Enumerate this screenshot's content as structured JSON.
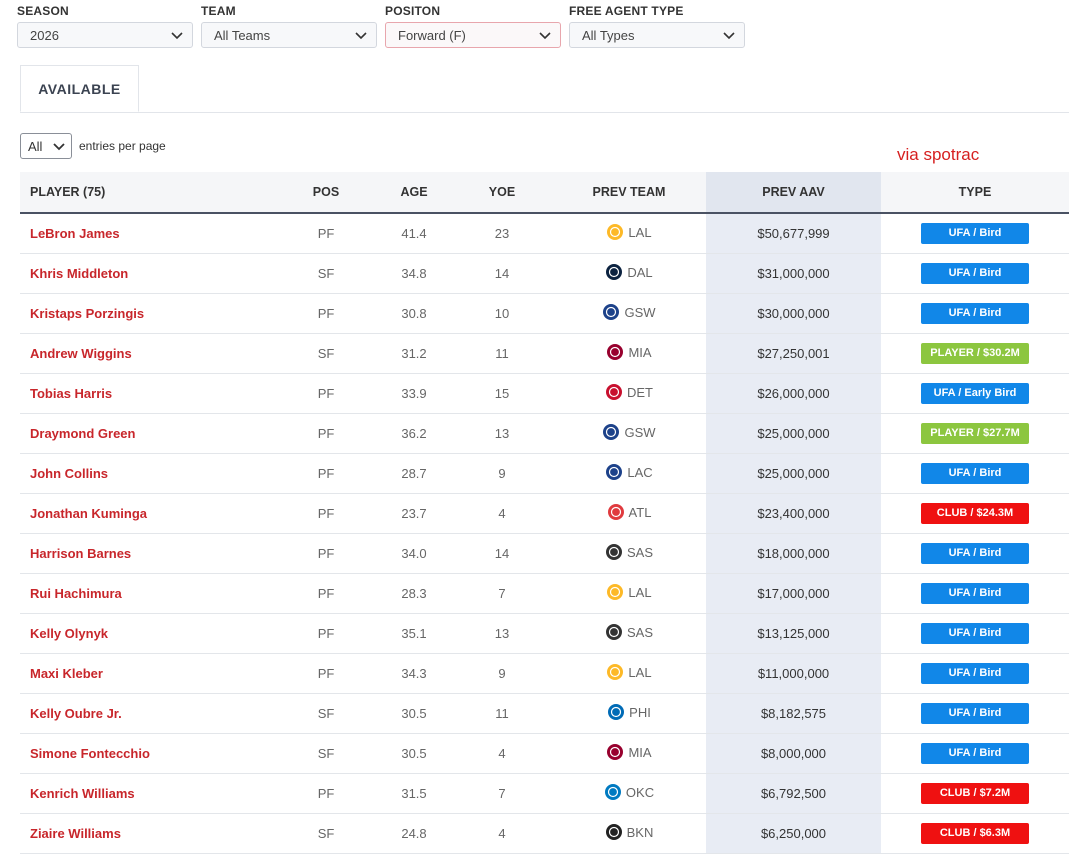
{
  "filters": {
    "season": {
      "label": "SEASON",
      "value": "2026"
    },
    "team": {
      "label": "TEAM",
      "value": "All Teams"
    },
    "position": {
      "label": "POSITON",
      "value": "Forward (F)"
    },
    "fa_type": {
      "label": "FREE AGENT TYPE",
      "value": "All Types"
    }
  },
  "tabs": {
    "available": "AVAILABLE"
  },
  "entries": {
    "value": "All",
    "label": "entries per page"
  },
  "credit": "via spotrac",
  "table": {
    "headers": {
      "player": "PLAYER (75)",
      "pos": "POS",
      "age": "AGE",
      "yoe": "YOE",
      "prev_team": "PREV TEAM",
      "prev_aav": "PREV AAV",
      "type": "TYPE"
    },
    "rows": [
      {
        "player": "LeBron James",
        "pos": "PF",
        "age": "41.4",
        "yoe": "23",
        "team": "LAL",
        "aav": "$50,677,999",
        "type": "UFA / Bird",
        "kind": "ufa"
      },
      {
        "player": "Khris Middleton",
        "pos": "SF",
        "age": "34.8",
        "yoe": "14",
        "team": "DAL",
        "aav": "$31,000,000",
        "type": "UFA / Bird",
        "kind": "ufa"
      },
      {
        "player": "Kristaps Porzingis",
        "pos": "PF",
        "age": "30.8",
        "yoe": "10",
        "team": "GSW",
        "aav": "$30,000,000",
        "type": "UFA / Bird",
        "kind": "ufa"
      },
      {
        "player": "Andrew Wiggins",
        "pos": "SF",
        "age": "31.2",
        "yoe": "11",
        "team": "MIA",
        "aav": "$27,250,001",
        "type": "PLAYER / $30.2M",
        "kind": "player"
      },
      {
        "player": "Tobias Harris",
        "pos": "PF",
        "age": "33.9",
        "yoe": "15",
        "team": "DET",
        "aav": "$26,000,000",
        "type": "UFA / Early Bird",
        "kind": "ufa"
      },
      {
        "player": "Draymond Green",
        "pos": "PF",
        "age": "36.2",
        "yoe": "13",
        "team": "GSW",
        "aav": "$25,000,000",
        "type": "PLAYER / $27.7M",
        "kind": "player"
      },
      {
        "player": "John Collins",
        "pos": "PF",
        "age": "28.7",
        "yoe": "9",
        "team": "LAC",
        "aav": "$25,000,000",
        "type": "UFA / Bird",
        "kind": "ufa"
      },
      {
        "player": "Jonathan Kuminga",
        "pos": "PF",
        "age": "23.7",
        "yoe": "4",
        "team": "ATL",
        "aav": "$23,400,000",
        "type": "CLUB / $24.3M",
        "kind": "club"
      },
      {
        "player": "Harrison Barnes",
        "pos": "PF",
        "age": "34.0",
        "yoe": "14",
        "team": "SAS",
        "aav": "$18,000,000",
        "type": "UFA / Bird",
        "kind": "ufa"
      },
      {
        "player": "Rui Hachimura",
        "pos": "PF",
        "age": "28.3",
        "yoe": "7",
        "team": "LAL",
        "aav": "$17,000,000",
        "type": "UFA / Bird",
        "kind": "ufa"
      },
      {
        "player": "Kelly Olynyk",
        "pos": "PF",
        "age": "35.1",
        "yoe": "13",
        "team": "SAS",
        "aav": "$13,125,000",
        "type": "UFA / Bird",
        "kind": "ufa"
      },
      {
        "player": "Maxi Kleber",
        "pos": "PF",
        "age": "34.3",
        "yoe": "9",
        "team": "LAL",
        "aav": "$11,000,000",
        "type": "UFA / Bird",
        "kind": "ufa"
      },
      {
        "player": "Kelly Oubre Jr.",
        "pos": "SF",
        "age": "30.5",
        "yoe": "11",
        "team": "PHI",
        "aav": "$8,182,575",
        "type": "UFA / Bird",
        "kind": "ufa"
      },
      {
        "player": "Simone Fontecchio",
        "pos": "SF",
        "age": "30.5",
        "yoe": "4",
        "team": "MIA",
        "aav": "$8,000,000",
        "type": "UFA / Bird",
        "kind": "ufa"
      },
      {
        "player": "Kenrich Williams",
        "pos": "PF",
        "age": "31.5",
        "yoe": "7",
        "team": "OKC",
        "aav": "$6,792,500",
        "type": "CLUB / $7.2M",
        "kind": "club"
      },
      {
        "player": "Ziaire Williams",
        "pos": "SF",
        "age": "24.8",
        "yoe": "4",
        "team": "BKN",
        "aav": "$6,250,000",
        "type": "CLUB / $6.3M",
        "kind": "club"
      }
    ]
  },
  "colors": {
    "ufa": "#1187e8",
    "player": "#8cc63f",
    "club": "#ef1111",
    "player_name": "#c8262b",
    "team_logos": {
      "LAL": "#fdb927",
      "DAL": "#0c2340",
      "GSW": "#1d428a",
      "MIA": "#98002e",
      "DET": "#c8102e",
      "LAC": "#1d428a",
      "ATL": "#e03a3e",
      "SAS": "#333333",
      "PHI": "#006bb6",
      "OKC": "#007ac1",
      "BKN": "#222222"
    }
  },
  "icons": {
    "dropdown": "chevron-down-icon",
    "team": "team-logo-icon"
  }
}
